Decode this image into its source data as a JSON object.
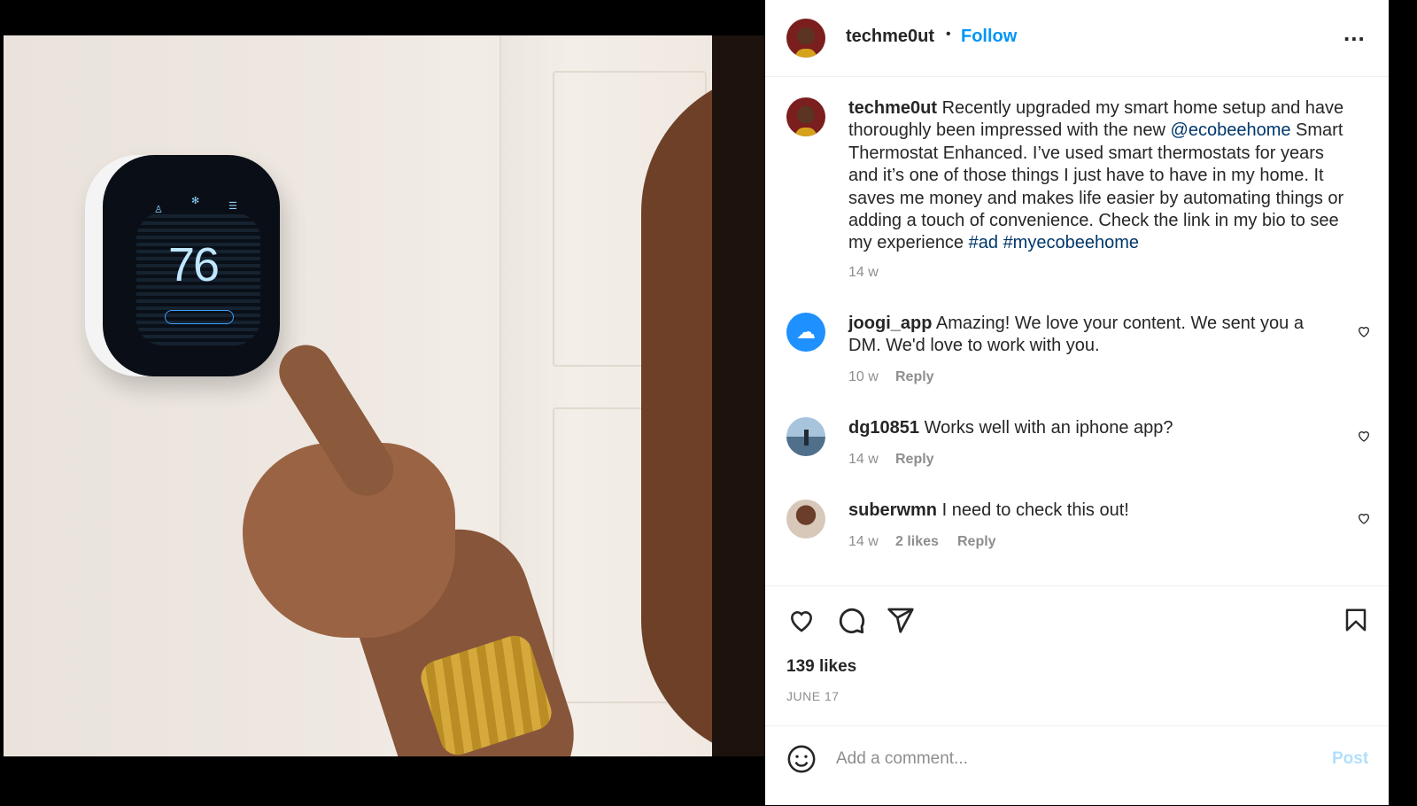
{
  "post": {
    "username": "techme0ut",
    "follow_label": "Follow",
    "separator": "•",
    "more_label": "...",
    "caption_username": "techme0ut",
    "caption_part1": " Recently upgraded my smart home setup and have thoroughly been impressed with the new ",
    "caption_mention": "@ecobeehome",
    "caption_part2": " Smart Thermostat Enhanced. I’ve used smart thermostats for years and it’s one of those things I just have to have in my home. It saves me money and makes life easier by automating things or adding a touch of convenience. Check the link in my bio to see my experience ",
    "caption_tag1": "#ad",
    "caption_tag2": "#myecobeehome",
    "caption_age": "14 w",
    "likes": "139 likes",
    "date": "JUNE 17",
    "add_comment_placeholder": "Add a comment...",
    "post_label": "Post"
  },
  "thermostat": {
    "temperature": "76"
  },
  "comments": [
    {
      "username": "joogi_app",
      "text": " Amazing! We love your content. We sent you a DM. We'd love to work with you.",
      "age": "10 w",
      "likes": "",
      "reply": "Reply"
    },
    {
      "username": "dg10851",
      "text": " Works well with an iphone app?",
      "age": "14 w",
      "likes": "",
      "reply": "Reply"
    },
    {
      "username": "suberwmn",
      "text": " I need to check this out!",
      "age": "14 w",
      "likes": "2 likes",
      "reply": "Reply"
    }
  ],
  "icons": {
    "like": "heart-icon",
    "comment": "comment-icon",
    "share": "send-icon",
    "save": "bookmark-icon",
    "emoji": "emoji-icon",
    "more": "more-options-icon"
  },
  "colors": {
    "accent": "#0095f6",
    "link": "#00376b",
    "post_disabled": "#b2dffc"
  }
}
